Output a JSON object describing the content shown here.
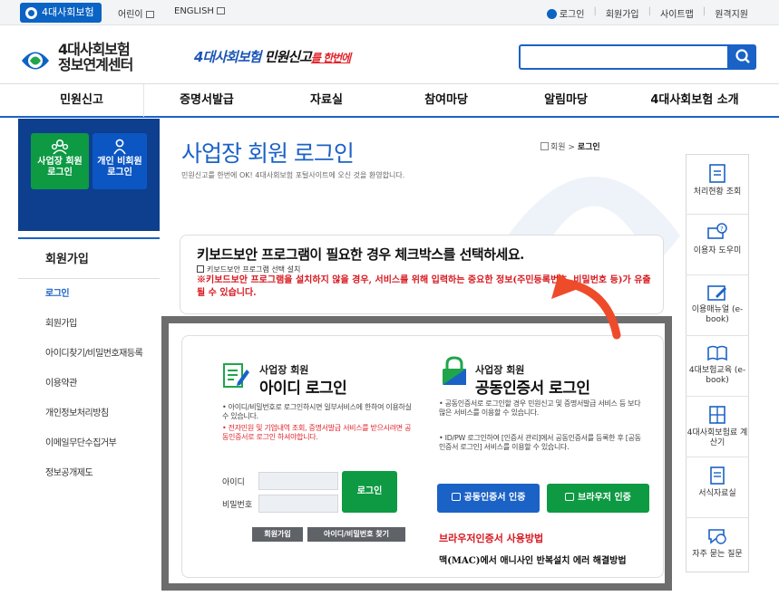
{
  "topbar": {
    "home": "4대사회보험",
    "kids": "어린이",
    "english": "ENGLISH",
    "login": "로그인",
    "join": "회원가입",
    "sitemap": "사이트맵",
    "remote": "원격지원"
  },
  "header": {
    "logo_line1": "4대사회보험",
    "logo_line2": "정보연계센터",
    "slogan_a": "4대사회보험",
    "slogan_b": " 민원신고",
    "slogan_c": "를 한번에"
  },
  "gnb": [
    "민원신고",
    "증명서발급",
    "자료실",
    "참여마당",
    "알림마당",
    "4대사회보험 소개"
  ],
  "lnb": {
    "btn_biz_1": "사업장 회원",
    "btn_biz_2": "로그인",
    "btn_ind_1": "개인 비회원",
    "btn_ind_2": "로그인",
    "title": "회원가입",
    "items": [
      "로그인",
      "회원가입",
      "아이디찾기/비밀번호재등록",
      "이용약관",
      "개인정보처리방침",
      "이메일무단수집거부",
      "정보공개제도"
    ]
  },
  "main": {
    "title": "사업장 회원 로그인",
    "subtitle": "민원신고를 한번에 OK! 4대사회보험 포털사이트에 오신 것을 환영합니다.",
    "crumb_a": "회원 > ",
    "crumb_b": "로그인",
    "kb_title": "키보드보안 프로그램이 필요한 경우 체크박스를 선택하세요.",
    "kb_check": "키보드보안 프로그램 선택 설치",
    "kb_warn": "※키보드보안 프로그램을 설치하지 않을 경우, 서비스를 위해 입력하는 중요한 정보(주민등록번호, 비밀번호 등)가 유출될 수 있습니다."
  },
  "login_id": {
    "small": "사업장 회원",
    "big": "아이디 로그인",
    "desc1": "• 아이디/비밀번호로 로그인하시면 일부서비스에 한하여 이용하실 수 있습니다.",
    "desc2": "• 전자민원 및 기업내역 조회, 증명서발급 서비스를 받으시려면 공동인증서로 로그인 하셔야합니다.",
    "id_label": "아이디",
    "pw_label": "비밀번호",
    "login_btn": "로그인",
    "join_btn": "회원가입",
    "find_btn": "아이디/비밀번호 찾기"
  },
  "login_cert": {
    "small": "사업장 회원",
    "big": "공동인증서 로그인",
    "desc1": "• 공동인증서로 로그인할 경우 민원신고 및 증명서발급 서비스 등 보다 많은 서비스를 이용할 수 있습니다.",
    "desc2": "• ID/PW 로그인하여 [인증서 관리]에서 공동인증서를 등록한 후 [공동인증서 로그인] 서비스를 이용할 수 있습니다.",
    "cert_btn": "공동인증서 인증",
    "browser_btn": "브라우저 인증",
    "browser_title": "브라우저인증서 사용방법",
    "browser_sub": "맥(MAC)에서 애니사인 반복설치 에러 해결방법"
  },
  "side": [
    "처리현황 조회",
    "이용자 도우미",
    "이용매뉴얼 (e-book)",
    "4대보험교육 (e-book)",
    "4대사회보험료 계산기",
    "서식자료실",
    "자주 묻는 질문"
  ],
  "colors": {
    "primary": "#1b62c6",
    "green": "#0d9a43",
    "red": "#d71920",
    "navy": "#0d3f8e"
  }
}
